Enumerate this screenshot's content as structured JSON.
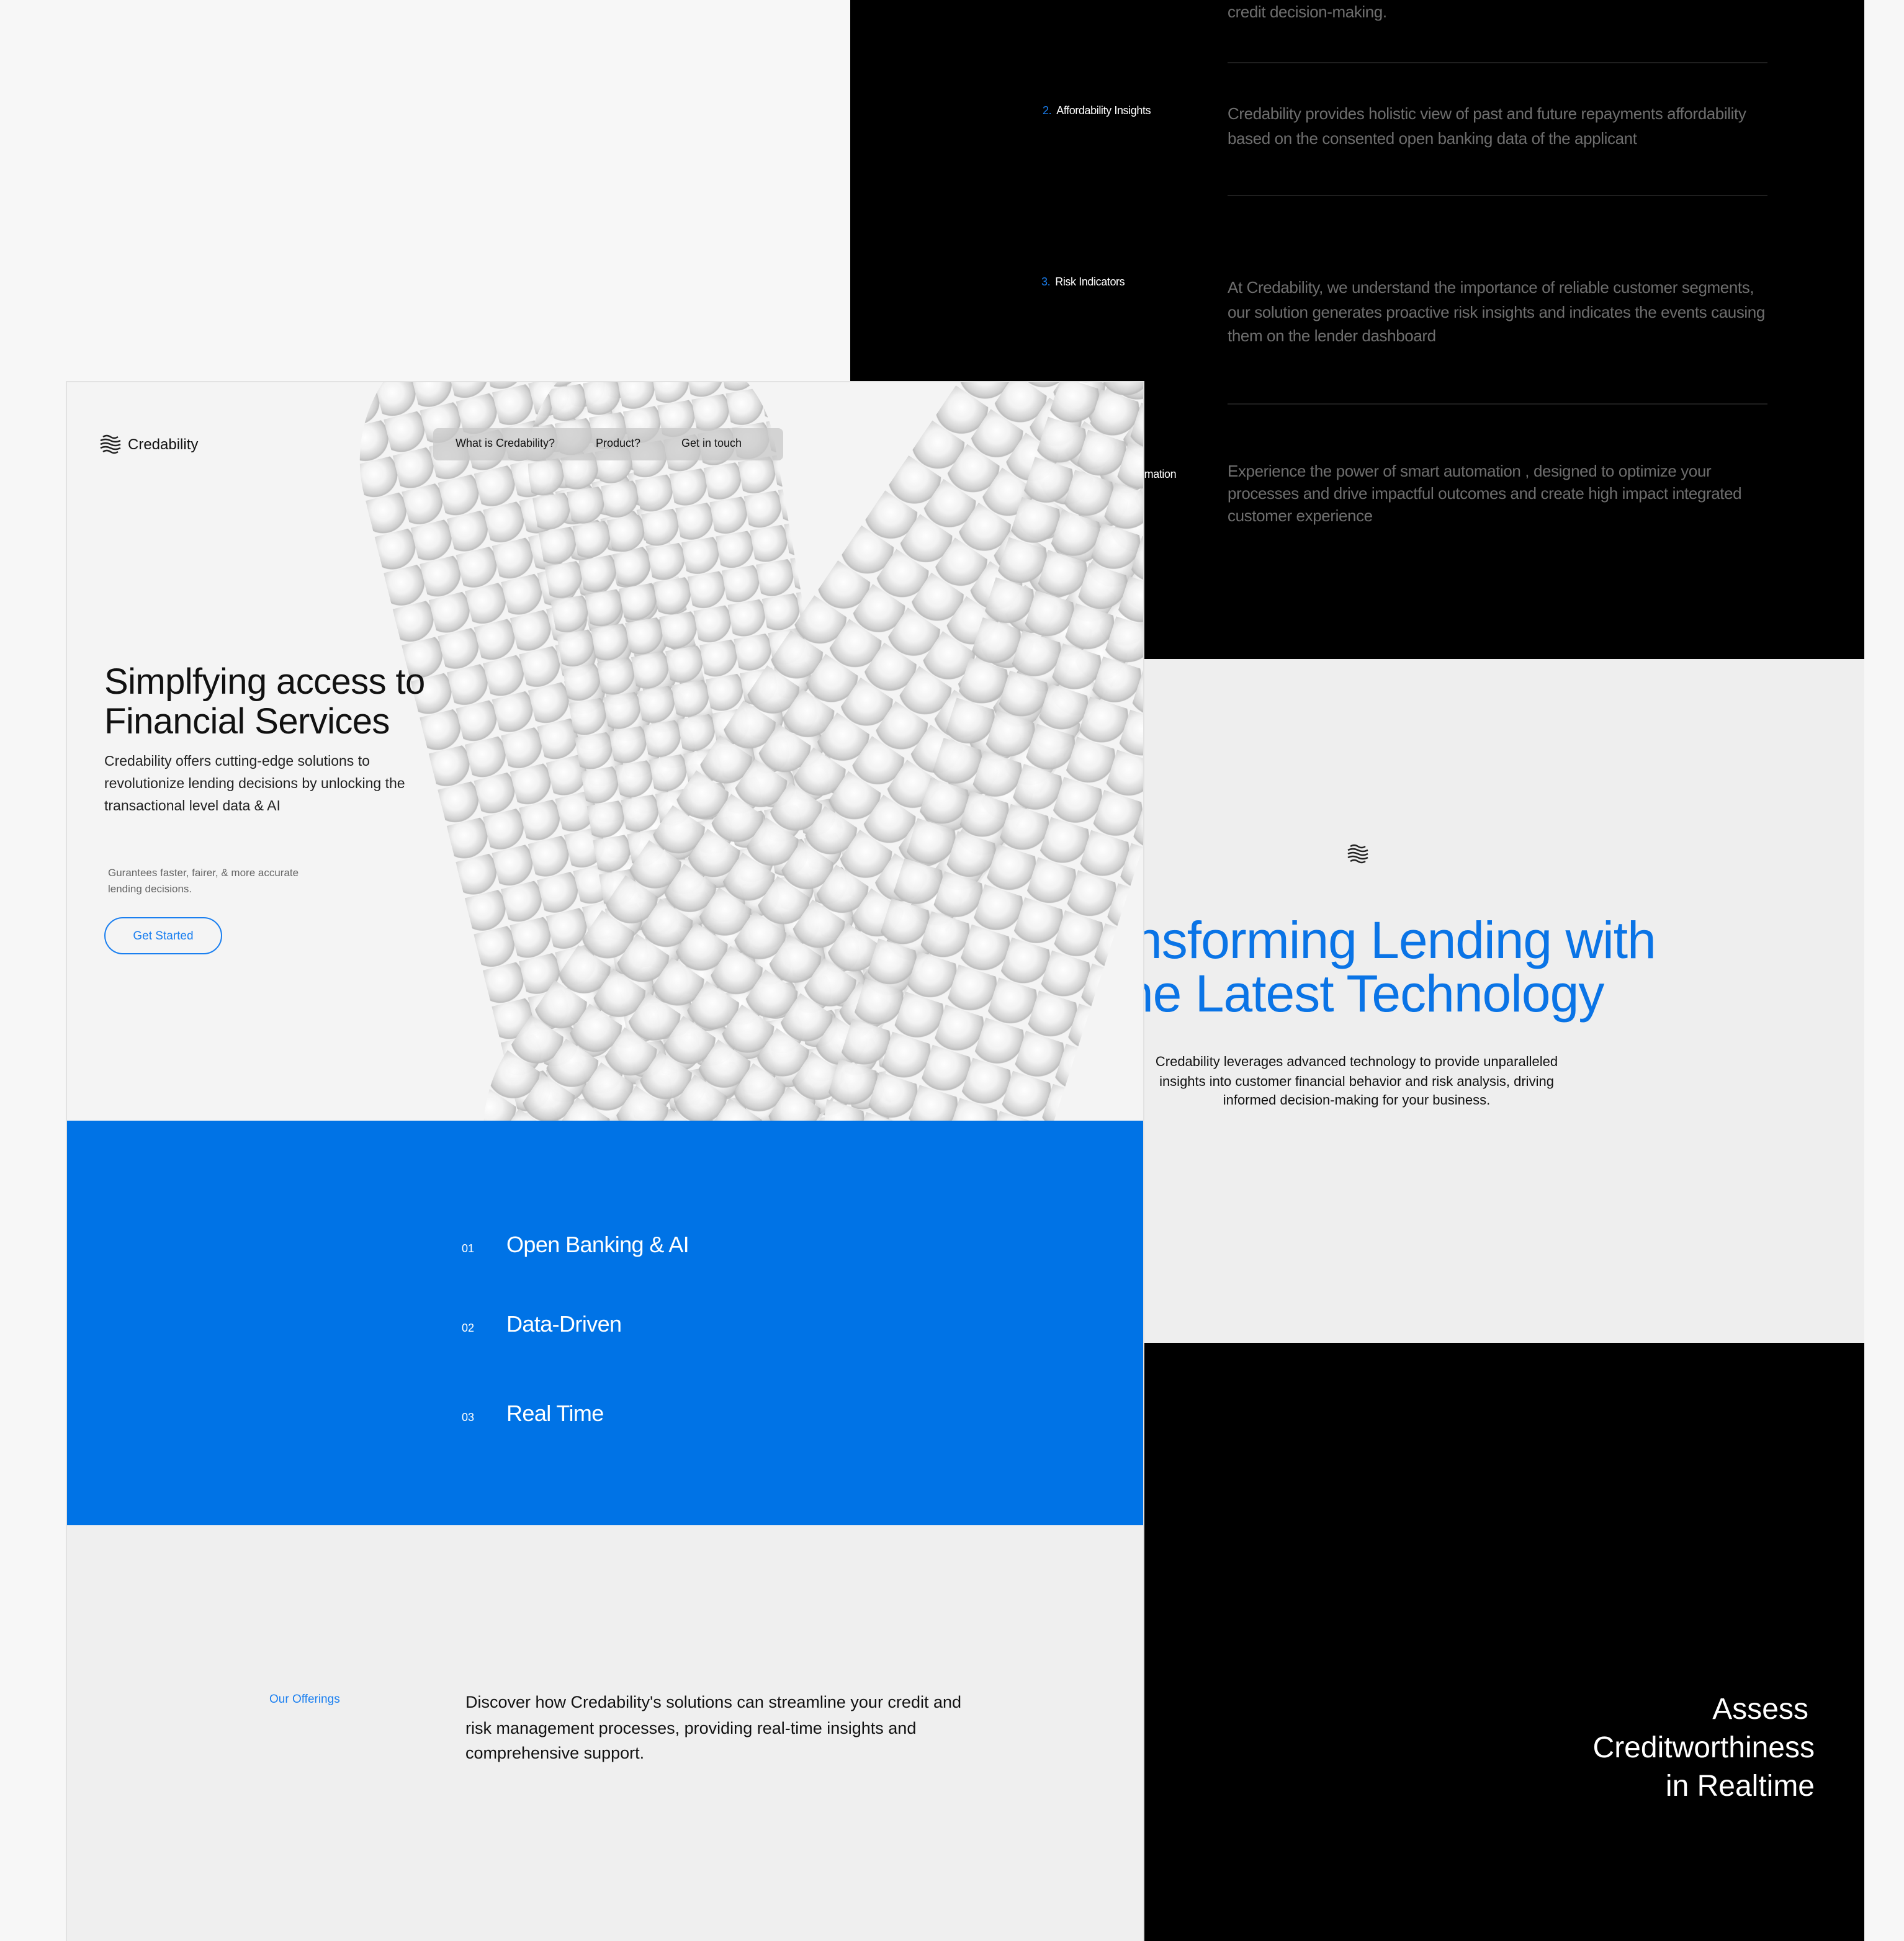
{
  "features_panel": {
    "top_desc_tail": "credit decision-making.",
    "items": [
      {
        "num": "2.",
        "label": "Affordability Insights",
        "desc": "Credability provides holistic view of past and future repayments affordability based on the consented open banking data of the applicant"
      },
      {
        "num": "3.",
        "label": "Risk Indicators",
        "desc": "At Credability, we understand the importance of reliable customer segments, our solution generates proactive risk insights and indicates the events causing them on the lender dashboard"
      },
      {
        "num": "",
        "label": "omation",
        "desc": "Experience the power of smart automation , designed to optimize your processes and drive impactful outcomes and create  high impact integrated customer experience"
      }
    ]
  },
  "tech": {
    "heading_line1": "Transforming Lending with",
    "heading_line2": "the Latest Technology",
    "body": "Credability leverages advanced technology to provide unparalleled insights into customer financial behavior and risk analysis, driving informed decision-making for your business."
  },
  "assess": {
    "line1": "Assess",
    "line2": "Creditworthiness",
    "line3": "in Realtime"
  },
  "header": {
    "brand": "Credability",
    "nav": [
      "What is Credability?",
      "Product?",
      "Get in touch"
    ]
  },
  "hero": {
    "title_line1": "Simplfying access to",
    "title_line2": "Financial Services",
    "lead": "Credability offers cutting-edge solutions to revolutionize lending decisions by unlocking the transactional level data & AI",
    "note": "Gurantees faster, fairer, & more accurate lending decisions.",
    "cta": "Get Started"
  },
  "highlights": [
    {
      "num": "01",
      "title": "Open Banking & AI"
    },
    {
      "num": "02",
      "title": "Data-Driven"
    },
    {
      "num": "03",
      "title": "Real Time"
    }
  ],
  "offerings": {
    "label": "Our Offerings",
    "text": "Discover how Credability's solutions can streamline your credit and risk management processes, providing real-time insights and comprehensive support."
  },
  "colors": {
    "accent": "#0073e6",
    "link": "#1a7ff0",
    "dark": "#000000"
  }
}
